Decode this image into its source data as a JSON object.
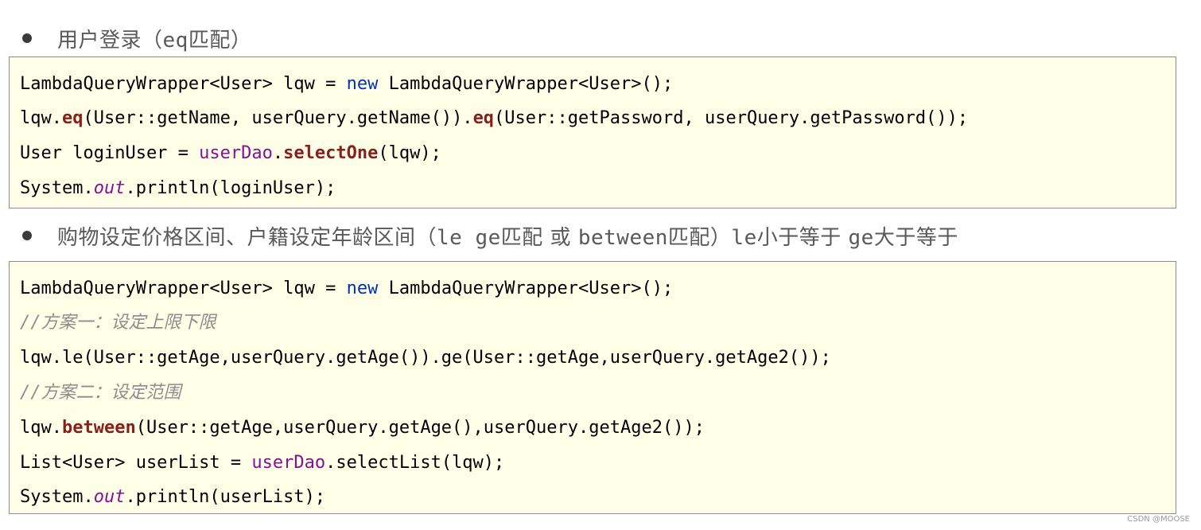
{
  "sections": [
    {
      "bullet": {
        "title": "用户登录（",
        "title_code": "eq",
        "title_tail": "匹配）"
      },
      "code": [
        {
          "parts": [
            "LambdaQueryWrapper<User> lqw = ",
            "new",
            " LambdaQueryWrapper<User>();"
          ]
        },
        {
          "parts": [
            "lqw.",
            "eq",
            "(User::getName, userQuery.getName()).",
            "eq",
            "(User::getPassword, userQuery.getPassword());"
          ]
        },
        {
          "parts": [
            "User loginUser = ",
            "userDao",
            ".",
            "selectOne",
            "(lqw);"
          ]
        },
        {
          "parts": [
            "System.",
            "out",
            ".println(loginUser);"
          ]
        }
      ]
    },
    {
      "bullet": {
        "p1": "购物设定价格区间、户籍设定年龄区间（",
        "c1": "le ge",
        "p2": "匹配  或  ",
        "c2": "between",
        "p3": "匹配）",
        "c3": "le",
        "p4": "小于等于 ",
        "c4": "ge",
        "p5": "大于等于"
      },
      "code": [
        {
          "parts": [
            "LambdaQueryWrapper<User> lqw = ",
            "new",
            " LambdaQueryWrapper<User>();"
          ]
        },
        {
          "parts": [
            "//方案一：设定上限下限"
          ]
        },
        {
          "parts": [
            "lqw.le(User::getAge,userQuery.getAge()).ge(User::getAge,userQuery.getAge2());"
          ]
        },
        {
          "parts": [
            "//方案二：设定范围"
          ]
        },
        {
          "parts": [
            "lqw.",
            "between",
            "(User::getAge,userQuery.getAge(),userQuery.getAge2());"
          ]
        },
        {
          "parts": [
            "List<User> userList = ",
            "userDao",
            ".selectList(lqw);"
          ]
        },
        {
          "parts": [
            "System.",
            "out",
            ".println(userList);"
          ]
        }
      ]
    }
  ],
  "watermark": "CSDN @MOOSE",
  "colors": {
    "keyword": "#0033b3",
    "method_bold": "#871f1f",
    "field": "#871094",
    "comment": "#8c8c8c",
    "box_bg": "#ffffe8",
    "box_border": "#8c8c8c"
  }
}
